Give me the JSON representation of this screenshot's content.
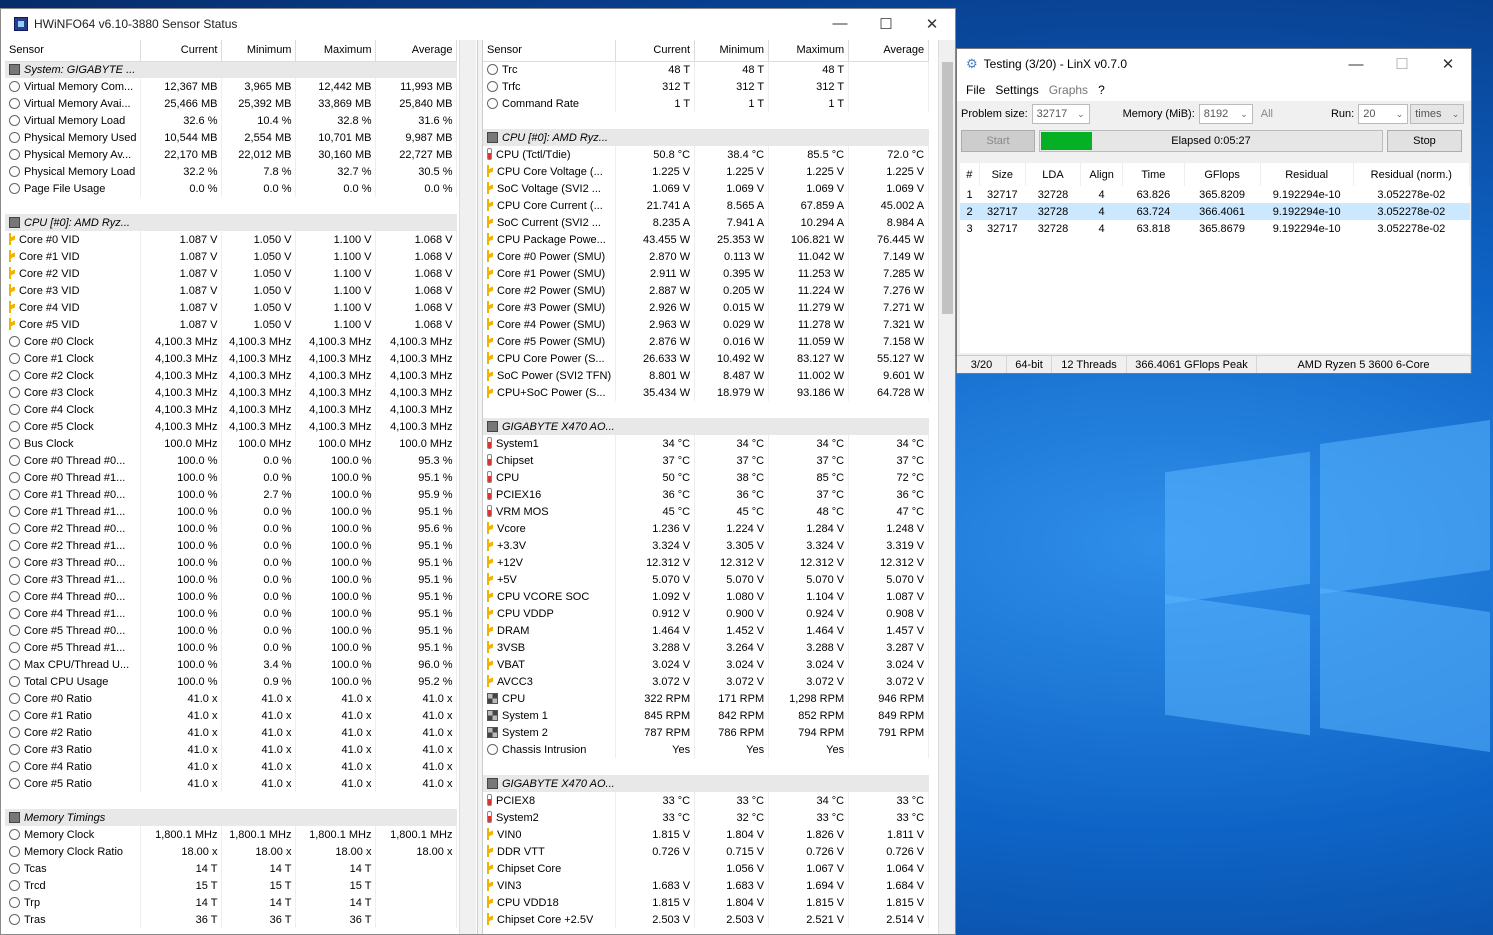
{
  "hwinfo": {
    "title": "HWiNFO64 v6.10-3880 Sensor Status",
    "headers": [
      "Sensor",
      "Current",
      "Minimum",
      "Maximum",
      "Average"
    ],
    "left": [
      [
        "g",
        "System: GIGABYTE ..."
      ],
      [
        "c",
        "Virtual Memory Com...",
        "12,367 MB",
        "3,965 MB",
        "12,442 MB",
        "11,993 MB"
      ],
      [
        "c",
        "Virtual Memory Avai...",
        "25,466 MB",
        "25,392 MB",
        "33,869 MB",
        "25,840 MB"
      ],
      [
        "c",
        "Virtual Memory Load",
        "32.6 %",
        "10.4 %",
        "32.8 %",
        "31.6 %"
      ],
      [
        "c",
        "Physical Memory Used",
        "10,544 MB",
        "2,554 MB",
        "10,701 MB",
        "9,987 MB"
      ],
      [
        "c",
        "Physical Memory Av...",
        "22,170 MB",
        "22,012 MB",
        "30,160 MB",
        "22,727 MB"
      ],
      [
        "c",
        "Physical Memory Load",
        "32.2 %",
        "7.8 %",
        "32.7 %",
        "30.5 %"
      ],
      [
        "c",
        "Page File Usage",
        "0.0 %",
        "0.0 %",
        "0.0 %",
        "0.0 %"
      ],
      [
        "b"
      ],
      [
        "g",
        "CPU [#0]: AMD Ryz..."
      ],
      [
        "v",
        "Core #0 VID",
        "1.087 V",
        "1.050 V",
        "1.100 V",
        "1.068 V"
      ],
      [
        "v",
        "Core #1 VID",
        "1.087 V",
        "1.050 V",
        "1.100 V",
        "1.068 V"
      ],
      [
        "v",
        "Core #2 VID",
        "1.087 V",
        "1.050 V",
        "1.100 V",
        "1.068 V"
      ],
      [
        "v",
        "Core #3 VID",
        "1.087 V",
        "1.050 V",
        "1.100 V",
        "1.068 V"
      ],
      [
        "v",
        "Core #4 VID",
        "1.087 V",
        "1.050 V",
        "1.100 V",
        "1.068 V"
      ],
      [
        "v",
        "Core #5 VID",
        "1.087 V",
        "1.050 V",
        "1.100 V",
        "1.068 V"
      ],
      [
        "c",
        "Core #0 Clock",
        "4,100.3 MHz",
        "4,100.3 MHz",
        "4,100.3 MHz",
        "4,100.3 MHz"
      ],
      [
        "c",
        "Core #1 Clock",
        "4,100.3 MHz",
        "4,100.3 MHz",
        "4,100.3 MHz",
        "4,100.3 MHz"
      ],
      [
        "c",
        "Core #2 Clock",
        "4,100.3 MHz",
        "4,100.3 MHz",
        "4,100.3 MHz",
        "4,100.3 MHz"
      ],
      [
        "c",
        "Core #3 Clock",
        "4,100.3 MHz",
        "4,100.3 MHz",
        "4,100.3 MHz",
        "4,100.3 MHz"
      ],
      [
        "c",
        "Core #4 Clock",
        "4,100.3 MHz",
        "4,100.3 MHz",
        "4,100.3 MHz",
        "4,100.3 MHz"
      ],
      [
        "c",
        "Core #5 Clock",
        "4,100.3 MHz",
        "4,100.3 MHz",
        "4,100.3 MHz",
        "4,100.3 MHz"
      ],
      [
        "c",
        "Bus Clock",
        "100.0 MHz",
        "100.0 MHz",
        "100.0 MHz",
        "100.0 MHz"
      ],
      [
        "c",
        "Core #0 Thread #0...",
        "100.0 %",
        "0.0 %",
        "100.0 %",
        "95.3 %"
      ],
      [
        "c",
        "Core #0 Thread #1...",
        "100.0 %",
        "0.0 %",
        "100.0 %",
        "95.1 %"
      ],
      [
        "c",
        "Core #1 Thread #0...",
        "100.0 %",
        "2.7 %",
        "100.0 %",
        "95.9 %"
      ],
      [
        "c",
        "Core #1 Thread #1...",
        "100.0 %",
        "0.0 %",
        "100.0 %",
        "95.1 %"
      ],
      [
        "c",
        "Core #2 Thread #0...",
        "100.0 %",
        "0.0 %",
        "100.0 %",
        "95.6 %"
      ],
      [
        "c",
        "Core #2 Thread #1...",
        "100.0 %",
        "0.0 %",
        "100.0 %",
        "95.1 %"
      ],
      [
        "c",
        "Core #3 Thread #0...",
        "100.0 %",
        "0.0 %",
        "100.0 %",
        "95.1 %"
      ],
      [
        "c",
        "Core #3 Thread #1...",
        "100.0 %",
        "0.0 %",
        "100.0 %",
        "95.1 %"
      ],
      [
        "c",
        "Core #4 Thread #0...",
        "100.0 %",
        "0.0 %",
        "100.0 %",
        "95.1 %"
      ],
      [
        "c",
        "Core #4 Thread #1...",
        "100.0 %",
        "0.0 %",
        "100.0 %",
        "95.1 %"
      ],
      [
        "c",
        "Core #5 Thread #0...",
        "100.0 %",
        "0.0 %",
        "100.0 %",
        "95.1 %"
      ],
      [
        "c",
        "Core #5 Thread #1...",
        "100.0 %",
        "0.0 %",
        "100.0 %",
        "95.1 %"
      ],
      [
        "c",
        "Max CPU/Thread U...",
        "100.0 %",
        "3.4 %",
        "100.0 %",
        "96.0 %"
      ],
      [
        "c",
        "Total CPU Usage",
        "100.0 %",
        "0.9 %",
        "100.0 %",
        "95.2 %"
      ],
      [
        "c",
        "Core #0 Ratio",
        "41.0 x",
        "41.0 x",
        "41.0 x",
        "41.0 x"
      ],
      [
        "c",
        "Core #1 Ratio",
        "41.0 x",
        "41.0 x",
        "41.0 x",
        "41.0 x"
      ],
      [
        "c",
        "Core #2 Ratio",
        "41.0 x",
        "41.0 x",
        "41.0 x",
        "41.0 x"
      ],
      [
        "c",
        "Core #3 Ratio",
        "41.0 x",
        "41.0 x",
        "41.0 x",
        "41.0 x"
      ],
      [
        "c",
        "Core #4 Ratio",
        "41.0 x",
        "41.0 x",
        "41.0 x",
        "41.0 x"
      ],
      [
        "c",
        "Core #5 Ratio",
        "41.0 x",
        "41.0 x",
        "41.0 x",
        "41.0 x"
      ],
      [
        "b"
      ],
      [
        "g",
        "Memory Timings"
      ],
      [
        "c",
        "Memory Clock",
        "1,800.1 MHz",
        "1,800.1 MHz",
        "1,800.1 MHz",
        "1,800.1 MHz"
      ],
      [
        "c",
        "Memory Clock Ratio",
        "18.00 x",
        "18.00 x",
        "18.00 x",
        "18.00 x"
      ],
      [
        "c",
        "Tcas",
        "14 T",
        "14 T",
        "14 T",
        ""
      ],
      [
        "c",
        "Trcd",
        "15 T",
        "15 T",
        "15 T",
        ""
      ],
      [
        "c",
        "Trp",
        "14 T",
        "14 T",
        "14 T",
        ""
      ],
      [
        "c",
        "Tras",
        "36 T",
        "36 T",
        "36 T",
        ""
      ]
    ],
    "right": [
      [
        "c",
        "Trc",
        "48 T",
        "48 T",
        "48 T",
        ""
      ],
      [
        "c",
        "Trfc",
        "312 T",
        "312 T",
        "312 T",
        ""
      ],
      [
        "c",
        "Command Rate",
        "1 T",
        "1 T",
        "1 T",
        ""
      ],
      [
        "b"
      ],
      [
        "g",
        "CPU [#0]: AMD Ryz..."
      ],
      [
        "t",
        "CPU (Tctl/Tdie)",
        "50.8 °C",
        "38.4 °C",
        "85.5 °C",
        "72.0 °C"
      ],
      [
        "v",
        "CPU Core Voltage (...",
        "1.225 V",
        "1.225 V",
        "1.225 V",
        "1.225 V"
      ],
      [
        "v",
        "SoC Voltage (SVI2 ...",
        "1.069 V",
        "1.069 V",
        "1.069 V",
        "1.069 V"
      ],
      [
        "v",
        "CPU Core Current (...",
        "21.741 A",
        "8.565 A",
        "67.859 A",
        "45.002 A"
      ],
      [
        "v",
        "SoC Current (SVI2 ...",
        "8.235 A",
        "7.941 A",
        "10.294 A",
        "8.984 A"
      ],
      [
        "v",
        "CPU Package Powe...",
        "43.455 W",
        "25.353 W",
        "106.821 W",
        "76.445 W"
      ],
      [
        "v",
        "Core #0 Power (SMU)",
        "2.870 W",
        "0.113 W",
        "11.042 W",
        "7.149 W"
      ],
      [
        "v",
        "Core #1 Power (SMU)",
        "2.911 W",
        "0.395 W",
        "11.253 W",
        "7.285 W"
      ],
      [
        "v",
        "Core #2 Power (SMU)",
        "2.887 W",
        "0.205 W",
        "11.224 W",
        "7.276 W"
      ],
      [
        "v",
        "Core #3 Power (SMU)",
        "2.926 W",
        "0.015 W",
        "11.279 W",
        "7.271 W"
      ],
      [
        "v",
        "Core #4 Power (SMU)",
        "2.963 W",
        "0.029 W",
        "11.278 W",
        "7.321 W"
      ],
      [
        "v",
        "Core #5 Power (SMU)",
        "2.876 W",
        "0.016 W",
        "11.059 W",
        "7.158 W"
      ],
      [
        "v",
        "CPU Core Power (S...",
        "26.633 W",
        "10.492 W",
        "83.127 W",
        "55.127 W"
      ],
      [
        "v",
        "SoC Power (SVI2 TFN)",
        "8.801 W",
        "8.487 W",
        "11.002 W",
        "9.601 W"
      ],
      [
        "v",
        "CPU+SoC Power (S...",
        "35.434 W",
        "18.979 W",
        "93.186 W",
        "64.728 W"
      ],
      [
        "b"
      ],
      [
        "g",
        "GIGABYTE X470 AO..."
      ],
      [
        "t",
        "System1",
        "34 °C",
        "34 °C",
        "34 °C",
        "34 °C"
      ],
      [
        "t",
        "Chipset",
        "37 °C",
        "37 °C",
        "37 °C",
        "37 °C"
      ],
      [
        "t",
        "CPU",
        "50 °C",
        "38 °C",
        "85 °C",
        "72 °C"
      ],
      [
        "t",
        "PCIEX16",
        "36 °C",
        "36 °C",
        "37 °C",
        "36 °C"
      ],
      [
        "t",
        "VRM MOS",
        "45 °C",
        "45 °C",
        "48 °C",
        "47 °C"
      ],
      [
        "v",
        "Vcore",
        "1.236 V",
        "1.224 V",
        "1.284 V",
        "1.248 V"
      ],
      [
        "v",
        "+3.3V",
        "3.324 V",
        "3.305 V",
        "3.324 V",
        "3.319 V"
      ],
      [
        "v",
        "+12V",
        "12.312 V",
        "12.312 V",
        "12.312 V",
        "12.312 V"
      ],
      [
        "v",
        "+5V",
        "5.070 V",
        "5.070 V",
        "5.070 V",
        "5.070 V"
      ],
      [
        "v",
        "CPU VCORE SOC",
        "1.092 V",
        "1.080 V",
        "1.104 V",
        "1.087 V"
      ],
      [
        "v",
        "CPU VDDP",
        "0.912 V",
        "0.900 V",
        "0.924 V",
        "0.908 V"
      ],
      [
        "v",
        "DRAM",
        "1.464 V",
        "1.452 V",
        "1.464 V",
        "1.457 V"
      ],
      [
        "v",
        "3VSB",
        "3.288 V",
        "3.264 V",
        "3.288 V",
        "3.287 V"
      ],
      [
        "v",
        "VBAT",
        "3.024 V",
        "3.024 V",
        "3.024 V",
        "3.024 V"
      ],
      [
        "v",
        "AVCC3",
        "3.072 V",
        "3.072 V",
        "3.072 V",
        "3.072 V"
      ],
      [
        "f",
        "CPU",
        "322 RPM",
        "171 RPM",
        "1,298 RPM",
        "946 RPM"
      ],
      [
        "f",
        "System 1",
        "845 RPM",
        "842 RPM",
        "852 RPM",
        "849 RPM"
      ],
      [
        "f",
        "System 2",
        "787 RPM",
        "786 RPM",
        "794 RPM",
        "791 RPM"
      ],
      [
        "c",
        "Chassis Intrusion",
        "Yes",
        "Yes",
        "Yes",
        ""
      ],
      [
        "b"
      ],
      [
        "g",
        "GIGABYTE X470 AO..."
      ],
      [
        "t",
        "PCIEX8",
        "33 °C",
        "33 °C",
        "34 °C",
        "33 °C"
      ],
      [
        "t",
        "System2",
        "33 °C",
        "32 °C",
        "33 °C",
        "33 °C"
      ],
      [
        "v",
        "VIN0",
        "1.815 V",
        "1.804 V",
        "1.826 V",
        "1.811 V"
      ],
      [
        "v",
        "DDR VTT",
        "0.726 V",
        "0.715 V",
        "0.726 V",
        "0.726 V"
      ],
      [
        "v",
        "Chipset Core",
        "",
        "1.056 V",
        "1.067 V",
        "1.064 V"
      ],
      [
        "v",
        "VIN3",
        "1.683 V",
        "1.683 V",
        "1.694 V",
        "1.684 V"
      ],
      [
        "v",
        "CPU VDD18",
        "1.815 V",
        "1.804 V",
        "1.815 V",
        "1.815 V"
      ],
      [
        "v",
        "Chipset Core +2.5V",
        "2.503 V",
        "2.503 V",
        "2.521 V",
        "2.514 V"
      ]
    ]
  },
  "linx": {
    "title": "Testing (3/20) - LinX v0.7.0",
    "menu": [
      "File",
      "Settings",
      "Graphs",
      "?"
    ],
    "problem_label": "Problem size:",
    "problem_value": "32717",
    "memory_label": "Memory (MiB):",
    "memory_value": "8192",
    "all_label": "All",
    "run_label": "Run:",
    "run_value": "20",
    "times_value": "times",
    "start": "Start",
    "stop": "Stop",
    "elapsed": "Elapsed 0:05:27",
    "progress": 0.15,
    "columns": [
      "#",
      "Size",
      "LDA",
      "Align",
      "Time",
      "GFlops",
      "Residual",
      "Residual (norm.)"
    ],
    "rows": [
      [
        "1",
        "32717",
        "32728",
        "4",
        "63.826",
        "365.8209",
        "9.192294e-10",
        "3.052278e-02"
      ],
      [
        "2",
        "32717",
        "32728",
        "4",
        "63.724",
        "366.4061",
        "9.192294e-10",
        "3.052278e-02"
      ],
      [
        "3",
        "32717",
        "32728",
        "4",
        "63.818",
        "365.8679",
        "9.192294e-10",
        "3.052278e-02"
      ]
    ],
    "selected_row": 1,
    "status": [
      "3/20",
      "64-bit",
      "12 Threads",
      "366.4061 GFlops Peak",
      "AMD Ryzen 5 3600 6-Core"
    ]
  }
}
